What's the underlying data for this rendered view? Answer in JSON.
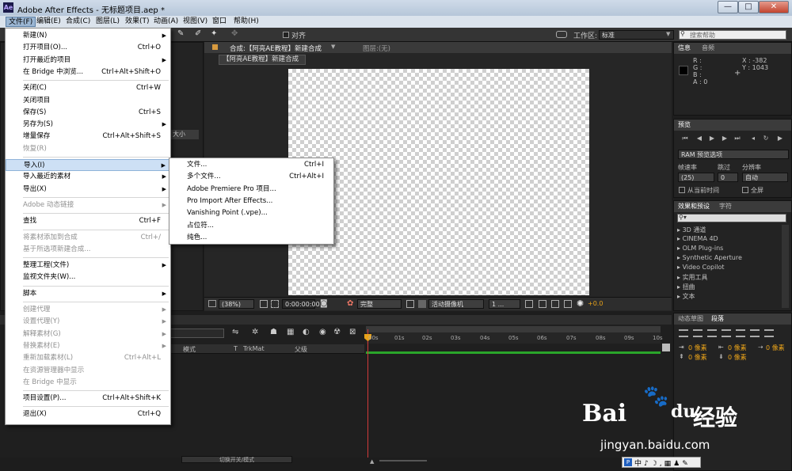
{
  "window": {
    "title": "Adobe After Effects - 无标题项目.aep *",
    "app_icon": "Ae",
    "minimize": "—",
    "maximize": "□",
    "close": "✕"
  },
  "menubar": [
    "文件(F)",
    "编辑(E)",
    "合成(C)",
    "图层(L)",
    "效果(T)",
    "动画(A)",
    "视图(V)",
    "窗口",
    "帮助(H)"
  ],
  "toolbar": {
    "snap_label": "对齐",
    "workspace_label": "工作区:",
    "workspace_value": "标准",
    "search_placeholder": "搜索帮助"
  },
  "file_menu": [
    {
      "label": "新建(N)",
      "sc": "",
      "sub": true
    },
    {
      "label": "打开项目(O)...",
      "sc": "Ctrl+O"
    },
    {
      "label": "打开最近的项目",
      "sc": "",
      "sub": true
    },
    {
      "label": "在 Bridge 中浏览...",
      "sc": "Ctrl+Alt+Shift+O"
    },
    {
      "sep": true
    },
    {
      "label": "关闭(C)",
      "sc": "Ctrl+W"
    },
    {
      "label": "关闭项目",
      "sc": ""
    },
    {
      "label": "保存(S)",
      "sc": "Ctrl+S"
    },
    {
      "label": "另存为(S)",
      "sc": "",
      "sub": true
    },
    {
      "label": "增量保存",
      "sc": "Ctrl+Alt+Shift+S"
    },
    {
      "label": "恢复(R)",
      "sc": "",
      "dis": true
    },
    {
      "sep": true
    },
    {
      "label": "导入(I)",
      "sc": "",
      "sub": true,
      "hl": true
    },
    {
      "label": "导入最近的素材",
      "sc": "",
      "sub": true
    },
    {
      "label": "导出(X)",
      "sc": "",
      "sub": true
    },
    {
      "sep": true
    },
    {
      "label": "Adobe 动态链接",
      "sc": "",
      "sub": true,
      "dis": true
    },
    {
      "sep": true
    },
    {
      "label": "查找",
      "sc": "Ctrl+F"
    },
    {
      "sep": true
    },
    {
      "label": "将素材添加到合成",
      "sc": "Ctrl+/",
      "dis": true
    },
    {
      "label": "基于所选项新建合成...",
      "sc": "",
      "dis": true
    },
    {
      "sep": true
    },
    {
      "label": "整理工程(文件)",
      "sc": "",
      "sub": true
    },
    {
      "label": "监视文件夹(W)...",
      "sc": ""
    },
    {
      "sep": true
    },
    {
      "label": "脚本",
      "sc": "",
      "sub": true
    },
    {
      "sep": true
    },
    {
      "label": "创建代理",
      "sc": "",
      "sub": true,
      "dis": true
    },
    {
      "label": "设置代理(Y)",
      "sc": "",
      "sub": true,
      "dis": true
    },
    {
      "label": "解释素材(G)",
      "sc": "",
      "sub": true,
      "dis": true
    },
    {
      "label": "替换素材(E)",
      "sc": "",
      "sub": true,
      "dis": true
    },
    {
      "label": "重新加载素材(L)",
      "sc": "Ctrl+Alt+L",
      "dis": true
    },
    {
      "label": "在资源管理器中显示",
      "sc": "",
      "dis": true
    },
    {
      "label": "在 Bridge 中显示",
      "sc": "",
      "dis": true
    },
    {
      "sep": true
    },
    {
      "label": "项目设置(P)...",
      "sc": "Ctrl+Alt+Shift+K"
    },
    {
      "sep": true
    },
    {
      "label": "退出(X)",
      "sc": "Ctrl+Q"
    }
  ],
  "import_menu": [
    {
      "label": "文件...",
      "sc": "Ctrl+I"
    },
    {
      "label": "多个文件...",
      "sc": "Ctrl+Alt+I"
    },
    {
      "label": "Adobe Premiere Pro 项目...",
      "sc": ""
    },
    {
      "label": "Pro Import After Effects...",
      "sc": ""
    },
    {
      "label": "Vanishing Point (.vpe)...",
      "sc": ""
    },
    {
      "label": "占位符...",
      "sc": ""
    },
    {
      "label": "纯色...",
      "sc": ""
    }
  ],
  "comp": {
    "tab": "合成:【阿亮AE教程】新建合成",
    "layer_tab": "图层:(无)",
    "breadcrumb": "【阿亮AE教程】新建合成",
    "zoom": "(38%)",
    "timecode": "0:00:00:00",
    "quality": "完整",
    "camera": "活动摄像机",
    "views": "1 ...",
    "exposure": "+0.0"
  },
  "project": {
    "col_size": "大小"
  },
  "info": {
    "tab": "信息",
    "tab2": "音频",
    "r": "R :",
    "g": "G :",
    "b": "B :",
    "a": "A : 0",
    "x": "X : -382",
    "y": "Y : 1043"
  },
  "preview": {
    "tab": "预览",
    "ram": "RAM 预览选项",
    "framerate_label": "帧速率",
    "skip_label": "跳过",
    "res_label": "分辨率",
    "framerate": "(25)",
    "skip": "0",
    "res": "自动",
    "from_current": "从当前时间",
    "fullscreen": "全屏"
  },
  "effects": {
    "tab": "效果和预设",
    "tab2": "字符",
    "items": [
      "3D 通道",
      "CINEMA 4D",
      "OLM Plug-ins",
      "Synthetic Aperture",
      "Video Copilot",
      "实用工具",
      "扭曲",
      "文本"
    ]
  },
  "paragraph": {
    "tab": "动态草图",
    "tab2": "段落",
    "px": [
      "0 像素",
      "0 像素",
      "0 像素",
      "0 像素",
      "0 像素"
    ]
  },
  "timeline": {
    "col_mode": "模式",
    "col_t": "T",
    "col_trkmat": "TrkMat",
    "col_parent": "父级",
    "ticks": [
      "00s",
      "01s",
      "02s",
      "03s",
      "04s",
      "05s",
      "06s",
      "07s",
      "08s",
      "09s",
      "10s"
    ],
    "toggle": "切换开关/模式"
  },
  "watermark": {
    "brand": "Bai",
    "paw": "du",
    "jy": "经验",
    "url": "jingyan.baidu.com"
  },
  "colors": {
    "accent": "#9bb6d3",
    "playhead": "#d23a3a",
    "workbar": "#2aa52a",
    "cti": "#e8a21a"
  }
}
